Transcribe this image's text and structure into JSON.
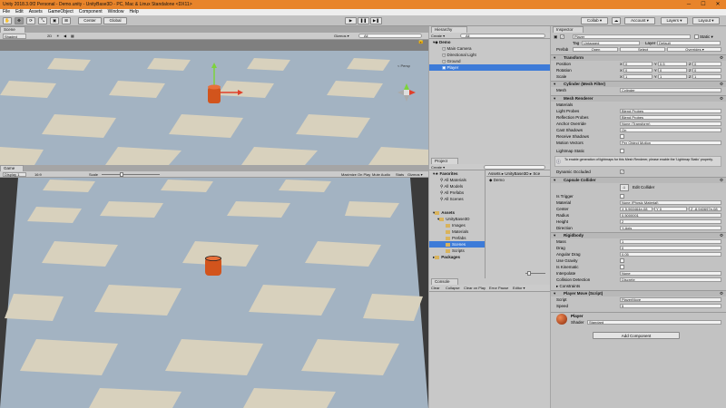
{
  "title_bar": {
    "text": "Unity 2018.3.0f2 Personal - Demo.unity - UnityBase3D - PC, Mac & Linux Standalone <DX11>",
    "min": "─",
    "max": "☐",
    "close": "✕"
  },
  "menu": [
    "File",
    "Edit",
    "Assets",
    "GameObject",
    "Component",
    "Window",
    "Help"
  ],
  "toolbar": {
    "pivot": "Center",
    "space": "Global",
    "play": "▶",
    "pause": "❚❚",
    "step": "▶❚",
    "collab": "Collab ▾",
    "account": "Account ▾",
    "layers": "Layers ▾",
    "layout": "Layout ▾"
  },
  "scene": {
    "tab": "Scene",
    "shading": "Shaded",
    "mode_2d": "2D",
    "gizmos": "Gizmos ▾",
    "search": "All",
    "persp": "< Persp"
  },
  "game": {
    "tab": "Game",
    "display": "Display 1",
    "aspect": "16:9",
    "scale_label": "Scale",
    "scale_value": 0.35,
    "maximize": "Maximize On Play",
    "mute": "Mute Audio",
    "stats": "Stats",
    "gizmos": "Gizmos ▾"
  },
  "hierarchy": {
    "tab": "Hierarchy",
    "create": "Create ▾",
    "search": "All",
    "scene": "Demo",
    "items": [
      "Main Camera",
      "Directional Light",
      "Ground",
      "Player"
    ]
  },
  "project": {
    "tab": "Project",
    "create": "Create ▾",
    "favorites_label": "Favorites",
    "favorites": [
      "All Materials",
      "All Models",
      "All Prefabs",
      "All Scenes"
    ],
    "assets_label": "Assets",
    "tree": [
      "UnityBase3D",
      "Images",
      "Materials",
      "Prefabs",
      "Scenes",
      "Scripts"
    ],
    "packages": "Packages",
    "breadcrumb": [
      "Assets",
      "UnityBase3D",
      "Sce"
    ],
    "files": [
      "Demo"
    ]
  },
  "console": {
    "tab": "Console",
    "buttons": [
      "Clear",
      "Collapse",
      "Clear on Play",
      "Error Pause",
      "Editor ▾"
    ]
  },
  "inspector": {
    "tab": "Inspector",
    "object_name": "Player",
    "static_label": "Static ▾",
    "tag_label": "Tag",
    "tag_value": "Untagged",
    "layer_label": "Layer",
    "layer_value": "Default",
    "prefab_label": "Prefab",
    "prefab_buttons": [
      "Open",
      "Select",
      "Overrides ▾"
    ],
    "transform": {
      "title": "Transform",
      "rows": [
        {
          "label": "Position",
          "x": "0",
          "y": "0.5",
          "z": "0"
        },
        {
          "label": "Rotation",
          "x": "0",
          "y": "0",
          "z": "0"
        },
        {
          "label": "Scale",
          "x": "1",
          "y": "1",
          "z": "1"
        }
      ]
    },
    "mesh_filter": {
      "title": "Cylinder (Mesh Filter)",
      "label": "Mesh",
      "value": "Cylinder"
    },
    "mesh_renderer": {
      "title": "Mesh Renderer",
      "materials": "Materials",
      "rows": [
        {
          "label": "Light Probes",
          "value": "Blend Probes"
        },
        {
          "label": "Reflection Probes",
          "value": "Blend Probes"
        },
        {
          "label": "Anchor Override",
          "value": "None (Transform)"
        },
        {
          "label": "Cast Shadows",
          "value": "On"
        },
        {
          "label": "Receive Shadows",
          "value": "✓"
        },
        {
          "label": "Motion Vectors",
          "value": "Per Object Motion"
        }
      ],
      "lightmap_static": "Lightmap Static",
      "info": "To enable generation of lightmaps for this Mesh Renderer, please enable the 'Lightmap Static' property.",
      "dynamic_occluded": "Dynamic Occluded"
    },
    "capsule_collider": {
      "title": "Capsule Collider",
      "edit": "Edit Collider",
      "rows": [
        {
          "label": "Is Trigger",
          "value": "✓"
        },
        {
          "label": "Material",
          "value": "None (Physic Material)"
        },
        {
          "label": "Center",
          "value": ""
        },
        {
          "label": "Radius",
          "value": "0.5000001"
        },
        {
          "label": "Height",
          "value": "2"
        },
        {
          "label": "Direction",
          "value": "Y-Axis"
        }
      ],
      "center": {
        "x": "X 5.960464e-08",
        "y": "Y 0",
        "z": "Z -8.940697e-08"
      }
    },
    "rigidbody": {
      "title": "Rigidbody",
      "rows": [
        {
          "label": "Mass",
          "value": "1"
        },
        {
          "label": "Drag",
          "value": "0"
        },
        {
          "label": "Angular Drag",
          "value": "0.05"
        },
        {
          "label": "Use Gravity",
          "value": "✓"
        },
        {
          "label": "Is Kinematic",
          "value": "✓"
        },
        {
          "label": "Interpolate",
          "value": "None"
        },
        {
          "label": "Collision Detection",
          "value": "Discrete"
        },
        {
          "label": "▸ Constraints",
          "value": ""
        }
      ]
    },
    "player_move": {
      "title": "Player Move (Script)",
      "rows": [
        {
          "label": "Script",
          "value": "PlayerMove"
        },
        {
          "label": "Speed",
          "value": "5"
        }
      ]
    },
    "material": {
      "name": "Player",
      "shader_label": "Shader",
      "shader_value": "Standard"
    },
    "add_component": "Add Component"
  },
  "colors": {
    "titlebar": "#e8842a",
    "selection": "#3d7bd8",
    "ground": "#a3b3c2",
    "tile": "#d8d1bd",
    "player": "#d2541c"
  }
}
